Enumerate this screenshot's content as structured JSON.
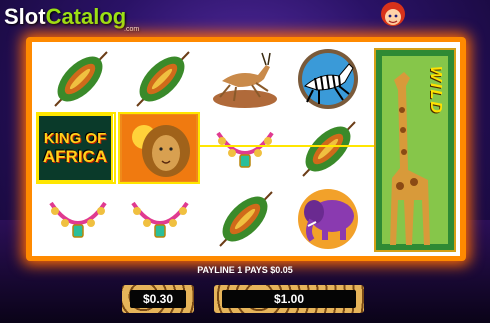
{
  "logo": {
    "slot": "Slot",
    "catalog": "Catalog",
    "domain": ".com"
  },
  "game_title": "",
  "symbols": [
    [
      "shield",
      "shield",
      "gazelle",
      "zebra",
      "wild-giraffe"
    ],
    [
      "king-of-africa",
      "lion",
      "necklace",
      "shield",
      "wild-giraffe"
    ],
    [
      "necklace",
      "necklace",
      "shield",
      "elephant",
      "wild-giraffe"
    ]
  ],
  "king_of_africa": {
    "line1": "KING OF",
    "line2": "AFRICA"
  },
  "wild_label": "WILD",
  "payline_text": "PAYLINE 1 PAYS $0.05",
  "bet_value": "$0.30",
  "win_value": "$1.00",
  "colors": {
    "frame": "#ff8a00",
    "payline": "#ffe600",
    "logo_accent": "#9be015"
  }
}
